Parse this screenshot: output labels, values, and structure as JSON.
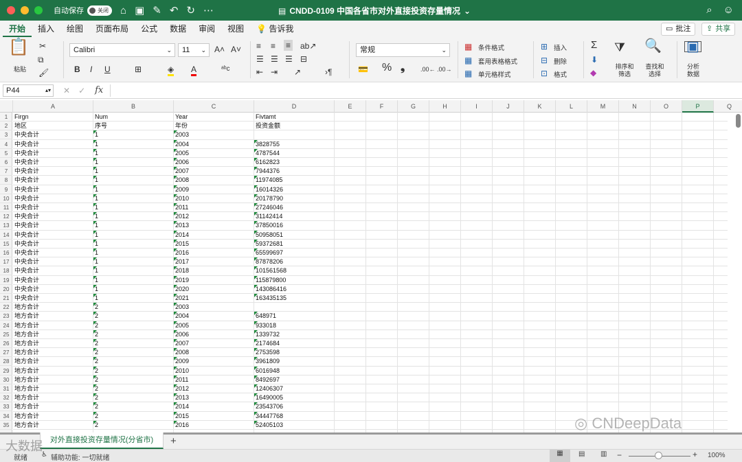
{
  "window": {
    "title": "CNDD-0109 中国各省市对外直接投资存量情况",
    "autosave_label": "自动保存",
    "autosave_state": "关闭",
    "traffic_colors": [
      "#fe5f57",
      "#febc2e",
      "#28c840"
    ]
  },
  "menu": {
    "tabs": [
      "开始",
      "插入",
      "绘图",
      "页面布局",
      "公式",
      "数据",
      "审阅",
      "视图",
      "告诉我"
    ],
    "comment_label": "批注",
    "share_label": "共享"
  },
  "ribbon": {
    "paste_label": "粘贴",
    "font_name": "Calibri",
    "font_size": "11",
    "number_format": "常规",
    "bold": "B",
    "italic": "I",
    "underline": "U",
    "conditional_format": "条件格式",
    "table_format": "套用表格格式",
    "cell_style": "单元格样式",
    "insert": "插入",
    "delete": "删除",
    "format": "格式",
    "sort_filter": "排序和筛选",
    "find_select": "查找和选择",
    "analyze_data": "分析数据"
  },
  "formula_bar": {
    "name_box": "P44",
    "fx": "fx",
    "content": ""
  },
  "sheet": {
    "columns": [
      "A",
      "B",
      "C",
      "D",
      "E",
      "F",
      "G",
      "H",
      "I",
      "J",
      "K",
      "L",
      "M",
      "N",
      "O",
      "P",
      "Q"
    ],
    "selected_column": "P",
    "rows": [
      [
        "Firgn",
        "Num",
        "Year",
        "Fivtamt"
      ],
      [
        "地区",
        "序号",
        "年份",
        "投资金额"
      ],
      [
        "中央合计",
        "1",
        "2003",
        ""
      ],
      [
        "中央合计",
        "1",
        "2004",
        "3828755"
      ],
      [
        "中央合计",
        "1",
        "2005",
        "4787544"
      ],
      [
        "中央合计",
        "1",
        "2006",
        "6162823"
      ],
      [
        "中央合计",
        "1",
        "2007",
        "7944376"
      ],
      [
        "中央合计",
        "1",
        "2008",
        "11974085"
      ],
      [
        "中央合计",
        "1",
        "2009",
        "16014326"
      ],
      [
        "中央合计",
        "1",
        "2010",
        "20178790"
      ],
      [
        "中央合计",
        "1",
        "2011",
        "27246046"
      ],
      [
        "中央合计",
        "1",
        "2012",
        "31142414"
      ],
      [
        "中央合计",
        "1",
        "2013",
        "37850016"
      ],
      [
        "中央合计",
        "1",
        "2014",
        "50958051"
      ],
      [
        "中央合计",
        "1",
        "2015",
        "59372681"
      ],
      [
        "中央合计",
        "1",
        "2016",
        "65599697"
      ],
      [
        "中央合计",
        "1",
        "2017",
        "87878206"
      ],
      [
        "中央合计",
        "1",
        "2018",
        "101561568"
      ],
      [
        "中央合计",
        "1",
        "2019",
        "115879800"
      ],
      [
        "中央合计",
        "1",
        "2020",
        "143086416"
      ],
      [
        "中央合计",
        "1",
        "2021",
        "163435135"
      ],
      [
        "地方合计",
        "2",
        "2003",
        ""
      ],
      [
        "地方合计",
        "2",
        "2004",
        "648971"
      ],
      [
        "地方合计",
        "2",
        "2005",
        "933018"
      ],
      [
        "地方合计",
        "2",
        "2006",
        "1339732"
      ],
      [
        "地方合计",
        "2",
        "2007",
        "2174684"
      ],
      [
        "地方合计",
        "2",
        "2008",
        "2753598"
      ],
      [
        "地方合计",
        "2",
        "2009",
        "3961809"
      ],
      [
        "地方合计",
        "2",
        "2010",
        "6016948"
      ],
      [
        "地方合计",
        "2",
        "2011",
        "8492697"
      ],
      [
        "地方合计",
        "2",
        "2012",
        "12406307"
      ],
      [
        "地方合计",
        "2",
        "2013",
        "16490005"
      ],
      [
        "地方合计",
        "2",
        "2014",
        "23543706"
      ],
      [
        "地方合计",
        "2",
        "2015",
        "34447768"
      ],
      [
        "地方合计",
        "2",
        "2016",
        "52405103"
      ]
    ]
  },
  "sheet_tab": "对外直接投资存量情况(分省市)",
  "status": {
    "ready": "就绪",
    "accessibility": "辅助功能: 一切就绪",
    "zoom": "100%"
  },
  "watermarks": [
    "CNDeepData",
    "大数据"
  ]
}
